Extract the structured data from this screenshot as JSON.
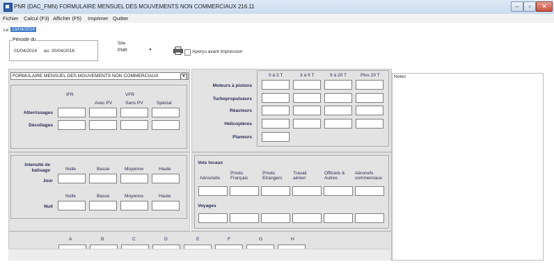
{
  "window": {
    "title": "PNR  (DAC_FMN) FORMULAIRE MENSUEL DES MOUVEMENTS NON COMMERCIAUX 216.11"
  },
  "menu": [
    "Fichier",
    "Calcul (F3)",
    "Afficher (F5)",
    "Imprimer",
    "Quitter"
  ],
  "header": {
    "le_label": "Le",
    "le_value": "13/04/2016",
    "periode_label": "Période du",
    "date_from": "01/04/2016",
    "au_label": "au",
    "date_to": "30/04/2016",
    "site_label": "Site",
    "site_value": "PNR",
    "apercu_label": "Aperçu avant impression"
  },
  "form_select": "FORMULAIRE MENSUEL DES MOUVEMENTS NON COMMERCIAUX",
  "vfr_section": {
    "ifr": "IFR",
    "vfr": "VFR",
    "cols": [
      "Avec PV",
      "Sans PV",
      "Spécial"
    ],
    "rows": [
      "Atterrissages",
      "Décollages"
    ]
  },
  "weights_section": {
    "cols": [
      "0 à 3 T",
      "3 à 9 T",
      "9 à 20 T",
      "Plus 20 T"
    ],
    "rows": [
      "Moteurs à pistons",
      "Turbopropulseurs",
      "Réacteurs",
      "Hélicoptères",
      "Planeurs"
    ]
  },
  "balisage": {
    "title": "Intensité de balisage",
    "jour": "Jour",
    "nuit": "Nuit",
    "cols": [
      "Nulle",
      "Basse",
      "Moyenne",
      "Haute"
    ]
  },
  "vols_locaux": {
    "title": "Vols locaux",
    "cols": [
      "Aéroclubs",
      "Privés Français",
      "Privés Etrangers",
      "Travail aérien",
      "Officiels & Autres",
      "Aéronefs commerciaux"
    ],
    "voyages": "Voyages"
  },
  "bottom_letters": [
    "A",
    "B",
    "C",
    "D",
    "E",
    "F",
    "G",
    "H"
  ],
  "notes_label": "Notes"
}
